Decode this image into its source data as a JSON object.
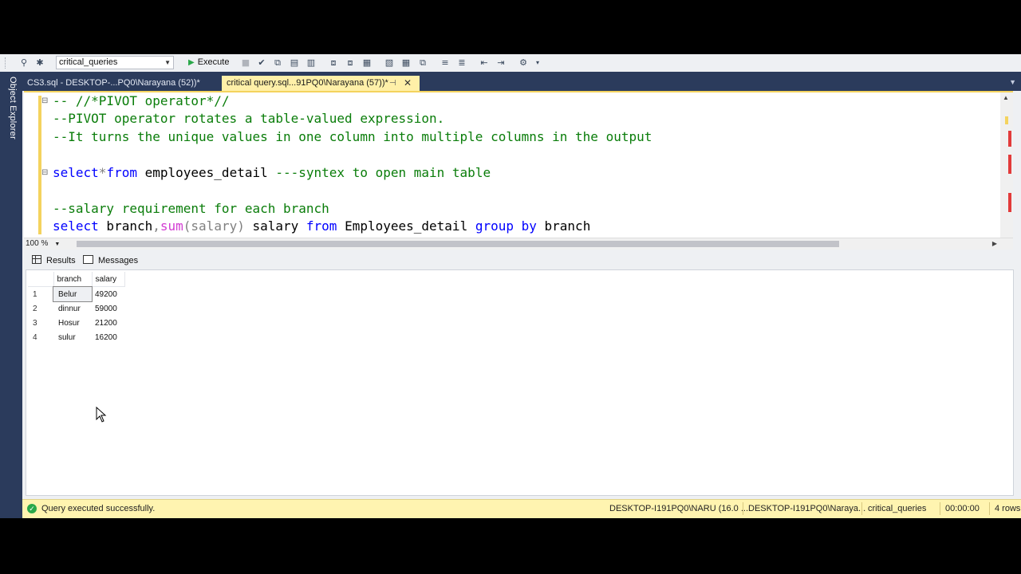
{
  "toolbar": {
    "database": "critical_queries",
    "execute_label": "Execute"
  },
  "sidebar": {
    "label": "Object Explorer"
  },
  "tabs": [
    {
      "label": "CS3.sql - DESKTOP-...PQ0\\Narayana (52))*"
    },
    {
      "label": "critical query.sql...91PQ0\\Narayana (57))*"
    }
  ],
  "editor": {
    "lines": [
      "-- //*PIVOT operator*//",
      "--PIVOT operator rotates a table-valued expression.",
      "--It turns the unique values in one column into multiple columns in the output",
      "",
      "select*from employees_detail ---syntex to open main table",
      "",
      "--salary requirement for each branch",
      "select branch,sum(salary) salary from Employees_detail group by branch"
    ],
    "tokens": {
      "select": "select",
      "star": "*",
      "from": "from",
      "table1": " employees_detail ",
      "comment1": "---syntex to open main table",
      "branch_comma": " branch",
      "comma": ",",
      "sum": "sum",
      "paren_salary": "(salary)",
      "salary_alias": " salary ",
      "table2": " Employees_detail ",
      "group_by": "group by",
      "branch_end": " branch"
    }
  },
  "zoom": "100 %",
  "results_tabs": {
    "results": "Results",
    "messages": "Messages"
  },
  "results": {
    "columns": [
      "branch",
      "salary"
    ],
    "rows": [
      {
        "n": "1",
        "branch": "Belur",
        "salary": "49200"
      },
      {
        "n": "2",
        "branch": "dinnur",
        "salary": "59000"
      },
      {
        "n": "3",
        "branch": "Hosur",
        "salary": "21200"
      },
      {
        "n": "4",
        "branch": "sulur",
        "salary": "16200"
      }
    ]
  },
  "status": {
    "message": "Query executed successfully.",
    "server": "DESKTOP-I191PQ0\\NARU (16.0 ...",
    "user": "DESKTOP-I191PQ0\\Naraya...",
    "database": "critical_queries",
    "time": "00:00:00",
    "rows": "4 rows"
  },
  "colors": {
    "comment": "#0a7d0a",
    "keyword": "#0000ff",
    "function": "#d33cd3",
    "active_tab": "#fff0a8",
    "statusbar": "#fff4b0",
    "chrome": "#2b3b5c"
  }
}
